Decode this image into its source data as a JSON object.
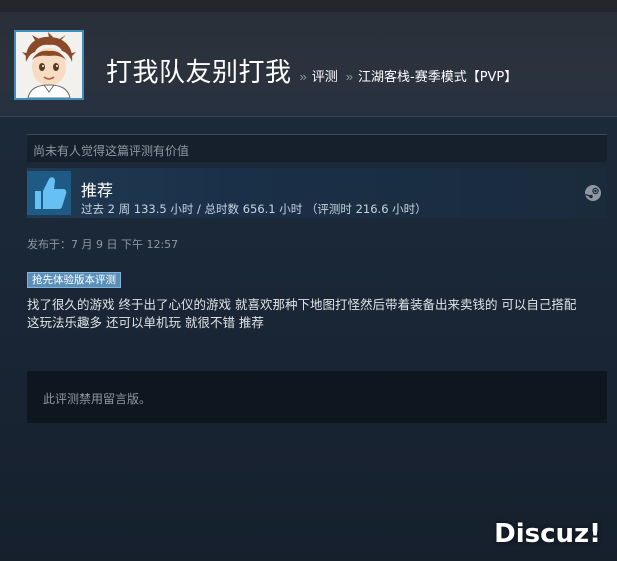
{
  "header": {
    "persona_name": "打我队友别打我",
    "breadcrumb": [
      {
        "label": "评测"
      },
      {
        "label": "江湖客栈-赛季模式【PVP】"
      }
    ],
    "separator": "»"
  },
  "review": {
    "helpful_text": "尚未有人觉得这篇评测有价值",
    "vote": {
      "title": "推荐",
      "hours": "过去 2 周 133.5 小时 / 总时数 656.1 小时 （评测时 216.6 小时）",
      "thumb_icon": "thumbs-up-icon",
      "platform_icon": "steam-icon"
    },
    "posted": "发布于：7 月 9 日 下午 12:57",
    "badge": "抢先体验版本评测",
    "text_lines": [
      "找了很久的游戏 终于出了心仪的游戏 就喜欢那种下地图打怪然后带着装备出来卖钱的 可以自己搭配",
      "这玩法乐趣多 还可以单机玩 就很不错 推荐"
    ],
    "comments_disabled": "此评测禁用留言版。"
  },
  "watermark": "Discuz!",
  "colors": {
    "background": "#1b2838",
    "accent": "#66c0f4",
    "badge": "#5b8fb7"
  }
}
